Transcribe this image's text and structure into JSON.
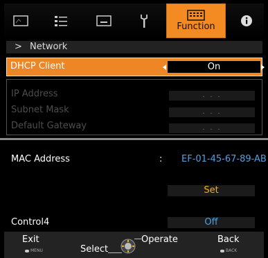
{
  "tabs": [
    {
      "icon": "picture-icon"
    },
    {
      "icon": "adjust-sliders-icon"
    },
    {
      "icon": "input-display-icon"
    },
    {
      "icon": "installation-wrench-icon"
    },
    {
      "icon": "function-keyboard-icon",
      "label": "Function",
      "active": true
    },
    {
      "icon": "info-icon"
    }
  ],
  "header": {
    "chevron": ">",
    "title": "Network"
  },
  "dhcp": {
    "label": "DHCP Client",
    "value": "On"
  },
  "ip": {
    "rows": [
      {
        "label": "IP Address",
        "value": ". . ."
      },
      {
        "label": "Subnet Mask",
        "value": ". . ."
      },
      {
        "label": "Default Gateway",
        "value": ". . ."
      }
    ]
  },
  "mac": {
    "label": "MAC Address",
    "colon": ":",
    "value": "EF-01-45-67-89-AB"
  },
  "set_button": {
    "label": "Set"
  },
  "control4": {
    "label": "Control4",
    "value": "Off"
  },
  "footer": {
    "exit": "Exit",
    "exit_key": "MENU",
    "select": "Select",
    "operate": "Operate",
    "back": "Back",
    "back_key": "BACK"
  },
  "colors": {
    "accent": "#ef8626",
    "value_blue": "#4fa3e0",
    "set_yellow": "#f0b020"
  }
}
